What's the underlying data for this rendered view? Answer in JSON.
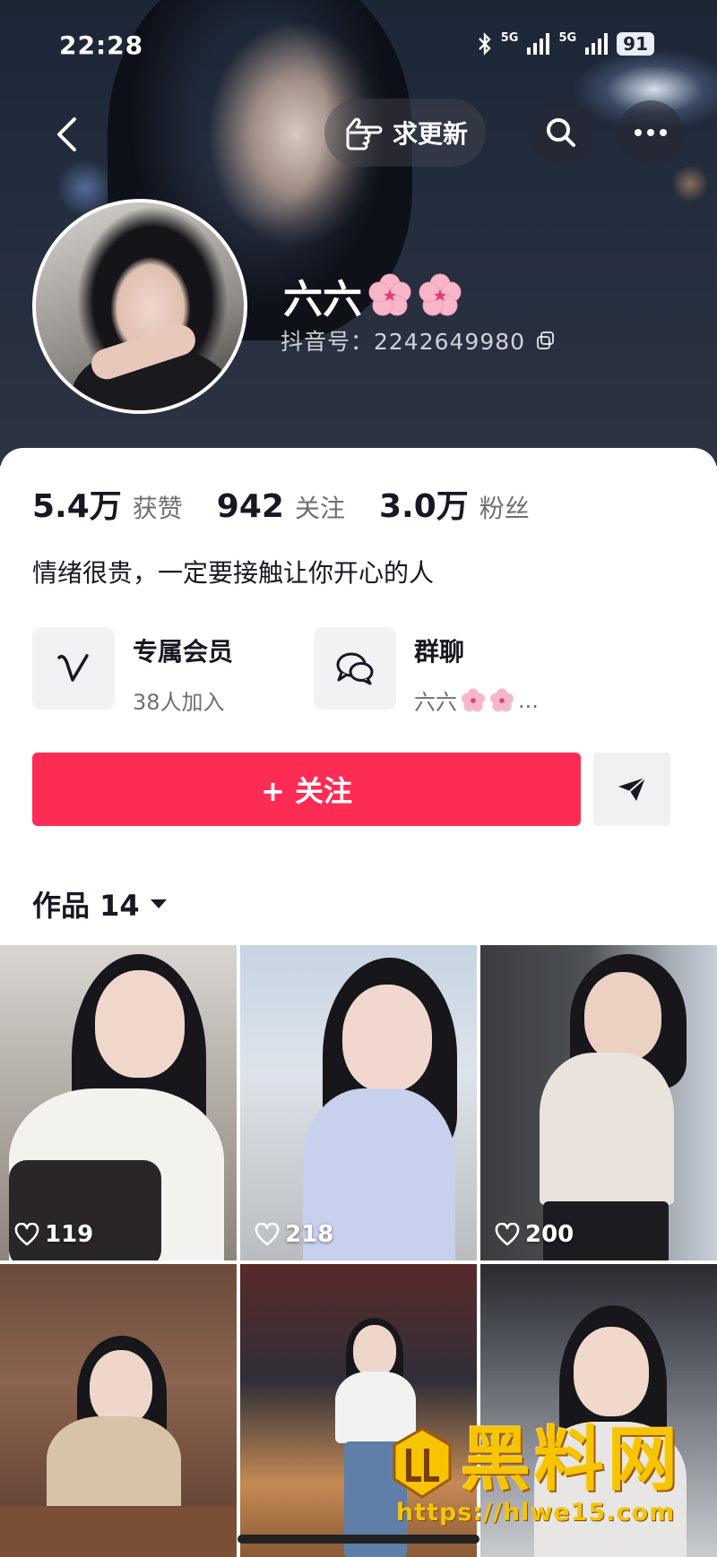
{
  "status_bar": {
    "time": "22:28",
    "network_1": "5G",
    "network_2": "5G",
    "battery": "91"
  },
  "header": {
    "request_update_label": "求更新",
    "name": "六六",
    "douyin_id": "抖音号：2242649980"
  },
  "stats": [
    {
      "value": "5.4万",
      "label": "获赞"
    },
    {
      "value": "942",
      "label": "关注"
    },
    {
      "value": "3.0万",
      "label": "粉丝"
    }
  ],
  "bio": "情绪很贵，一定要接触让你开心的人",
  "features": {
    "membership": {
      "title": "专属会员",
      "subtitle": "38人加入"
    },
    "group_chat": {
      "title": "群聊",
      "subtitle": "六六",
      "suffix": "..."
    }
  },
  "actions": {
    "follow_label": "+ 关注"
  },
  "works_tab": {
    "label": "作品 14"
  },
  "posts": [
    {
      "likes": "119"
    },
    {
      "likes": "218"
    },
    {
      "likes": "200"
    },
    {
      "likes": ""
    },
    {
      "likes": ""
    },
    {
      "likes": ""
    }
  ],
  "watermark": {
    "text": "黑料网",
    "url": "https://hlwe15.com"
  },
  "colors": {
    "accent": "#fe2c55",
    "watermark": "#f7c400"
  }
}
